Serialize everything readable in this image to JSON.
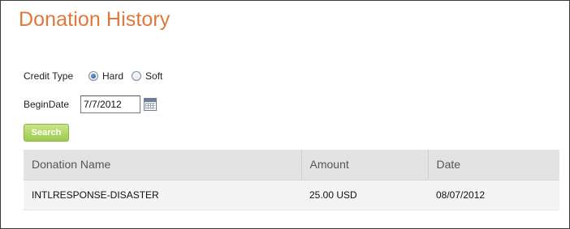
{
  "page": {
    "title": "Donation History"
  },
  "filters": {
    "credit_type_label": "Credit Type",
    "credit_options": [
      {
        "label": "Hard",
        "checked": true
      },
      {
        "label": "Soft",
        "checked": false
      }
    ],
    "begin_date_label": "BeginDate",
    "begin_date_value": "7/7/2012",
    "calendar_icon": "calendar-icon",
    "search_label": "Search"
  },
  "table": {
    "headers": [
      "Donation Name",
      "Amount",
      "Date"
    ],
    "rows": [
      [
        "INTLRESPONSE-DISASTER",
        "25.00 USD",
        "08/07/2012"
      ]
    ]
  },
  "colors": {
    "title": "#e0783a",
    "search_button": "#9ccb4f",
    "header_background": "#e3e3e3",
    "row_background": "#f4f4f4"
  }
}
